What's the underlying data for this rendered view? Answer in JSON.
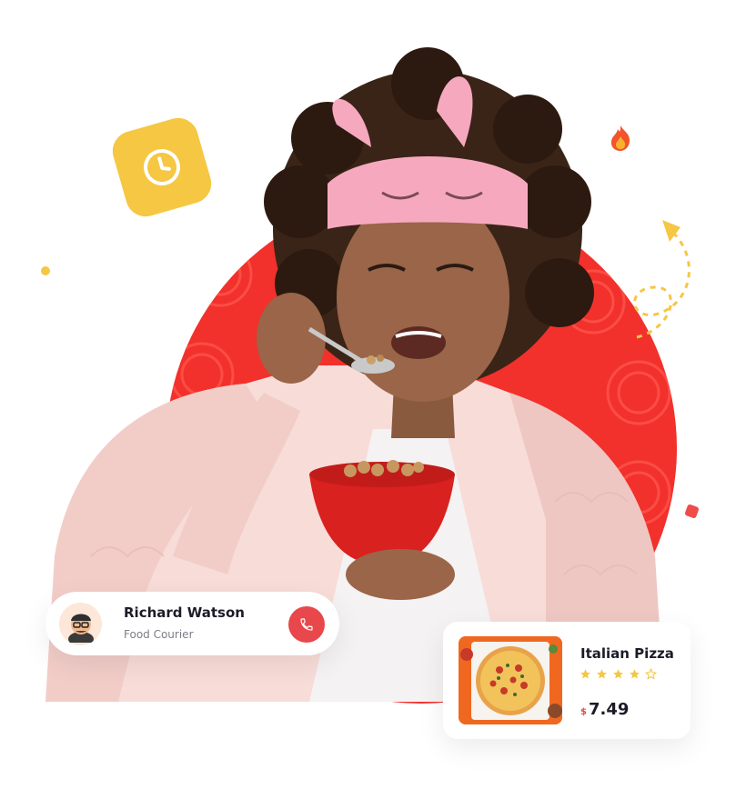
{
  "courier": {
    "name": "Richard Watson",
    "role": "Food Courier",
    "avatar_icon": "avatar-icon",
    "call_icon": "phone-icon"
  },
  "product": {
    "name": "Italian Pizza",
    "currency": "$",
    "price": "7.49",
    "rating": 4,
    "rating_max": 5,
    "image_icon": "pizza-image"
  },
  "decorations": {
    "clock_icon": "clock-icon",
    "fire_icon": "fire-icon",
    "arrow_icon": "dashed-arrow-icon"
  },
  "colors": {
    "accent_red": "#f2312c",
    "call_red": "#e8474b",
    "star_yellow": "#f5c742",
    "badge_yellow": "#f5c742",
    "text_dark": "#1c1c28",
    "text_muted": "#7d7d89"
  }
}
